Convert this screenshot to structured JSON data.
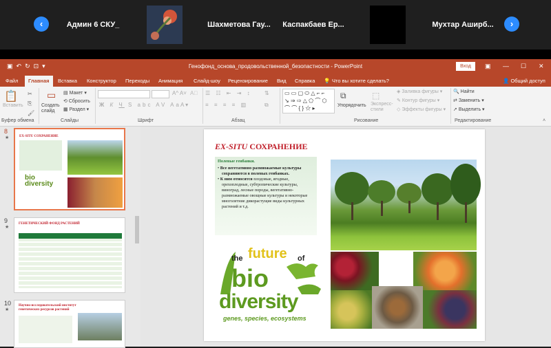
{
  "call": {
    "participants": [
      {
        "name": "Админ 6 СКУ_"
      },
      {
        "name": ""
      },
      {
        "name": "Шахметова  Гау..."
      },
      {
        "name": "Каспакбаев  Ер..."
      },
      {
        "name": ""
      },
      {
        "name": "Мухтар  Аширб..."
      }
    ],
    "prev_icon": "chevron-left-icon",
    "next_icon": "chevron-right-icon"
  },
  "window": {
    "title": "Генофонд_основа_продовольственной_безопастности  -  PowerPoint",
    "login_label": "Вход"
  },
  "tabs": [
    "Файл",
    "Главная",
    "Вставка",
    "Конструктор",
    "Переходы",
    "Анимация",
    "Слайд-шоу",
    "Рецензирование",
    "Вид",
    "Справка",
    "Что вы хотите сделать?"
  ],
  "share_label": "Общий доступ",
  "ribbon": {
    "paste": "Вставить",
    "new_slide": "Создать слайд",
    "layout": "Макет",
    "reset": "Сбросить",
    "section": "Раздел",
    "groups": [
      "Буфер обмена",
      "Слайды",
      "Шрифт",
      "Абзац",
      "Рисование",
      "Редактирование"
    ],
    "arrange": "Упорядочить",
    "quick_styles": "Экспресс-стили",
    "shape_fill": "Заливка фигуры",
    "shape_outline": "Контур фигуры",
    "shape_effects": "Эффекты фигуры",
    "find": "Найти",
    "replace": "Заменить",
    "select": "Выделить"
  },
  "thumbnails": [
    {
      "number": "8",
      "title": "EX-SITU СОХРАНЕНИЕ"
    },
    {
      "number": "9",
      "title": "ГЕНЕТИЧЕСКИЙ ФОНД РАСТЕНИЙ"
    },
    {
      "number": "10",
      "title": "Научно-исследовательский институт генетических ресурсов растений"
    }
  ],
  "slide": {
    "title_italic": "EX-SITU",
    "title_rest": " СОХРАНЕНИЕ",
    "subtitle": "Полевые генбанки.",
    "bullet_1": "Все вегетативно размножаемые культуры сохраняются в полевых генбанках.",
    "bullet_2_bold": "К ним относятся",
    "bullet_2_rest": " плодовые, ягодные, орехоплодные, субтропические культуры, виноград, лесные породы, вегетативно-размножаемые овощные культуры и некоторые многолетние дикорастущие виды культурных растений и т.д.",
    "logo_the": "the",
    "logo_future": "future",
    "logo_of": "of",
    "logo_bio": "bio",
    "logo_diversity": "diversity",
    "logo_tagline": "genes, species, ecosystems"
  },
  "colors": {
    "accent": "#b7472a",
    "title_red": "#c0202b",
    "green": "#6aa82a",
    "zoom_blue": "#2d8cff"
  }
}
